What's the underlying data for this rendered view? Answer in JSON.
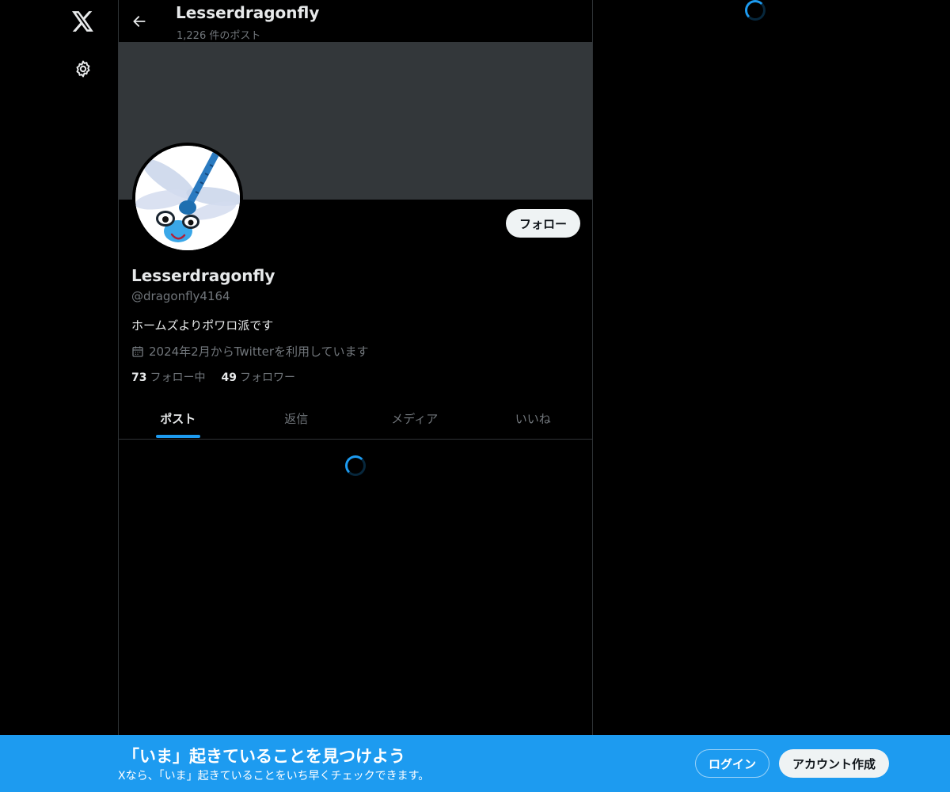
{
  "nav": {
    "logo_icon": "x-logo-icon",
    "settings_icon": "gear-icon"
  },
  "header": {
    "title": "Lesserdragonfly",
    "post_count": "1,226 件のポスト",
    "back_icon": "arrow-left-icon"
  },
  "profile": {
    "banner_color": "#33373a",
    "avatar_description": "dragonfly-avatar",
    "follow_label": "フォロー",
    "display_name": "Lesserdragonfly",
    "handle": "@dragonfly4164",
    "bio": "ホームズよりポワロ派です",
    "joined": "2024年2月からTwitterを利用しています",
    "joined_icon": "calendar-icon",
    "following_count": "73",
    "following_label": "フォロー中",
    "followers_count": "49",
    "followers_label": "フォロワー"
  },
  "tabs": [
    {
      "label": "ポスト",
      "active": true
    },
    {
      "label": "返信",
      "active": false
    },
    {
      "label": "メディア",
      "active": false
    },
    {
      "label": "いいね",
      "active": false
    }
  ],
  "bottom_bar": {
    "title": "「いま」起きていることを見つけよう",
    "subtitle": "Xなら、「いま」起きていることをいち早くチェックできます。",
    "login_label": "ログイン",
    "signup_label": "アカウント作成"
  },
  "colors": {
    "accent": "#1d9bf0",
    "background": "#000000",
    "muted_text": "#71767b",
    "primary_text": "#e7e9ea"
  }
}
